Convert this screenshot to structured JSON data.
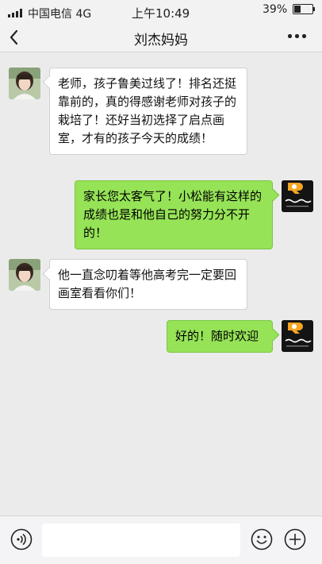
{
  "status_bar": {
    "carrier": "中国电信 4G",
    "time": "上午10:49",
    "battery": "39%"
  },
  "nav": {
    "title": "刘杰妈妈",
    "back_icon": "chevron-left-icon",
    "more_icon": "more-dots-icon"
  },
  "messages": [
    {
      "side": "left",
      "text": "老师，孩子鲁美过线了！排名还挺靠前的，真的得感谢老师对孩子的栽培了！还好当初选择了启点画室，才有的孩子今天的成绩！"
    },
    {
      "side": "right",
      "text": "家长您太客气了！小松能有这样的成绩也是和他自己的努力分不开的！"
    },
    {
      "side": "left",
      "text": "他一直念叨着等他高考完一定要回画室看看你们！"
    },
    {
      "side": "right",
      "text": "好的！随时欢迎"
    }
  ],
  "input_bar": {
    "placeholder": "",
    "icons": [
      "voice-icon",
      "emoji-icon",
      "plus-icon"
    ]
  },
  "colors": {
    "outgoing_bubble": "#96e357",
    "incoming_bubble": "#ffffff",
    "chat_background": "#ebebeb"
  }
}
